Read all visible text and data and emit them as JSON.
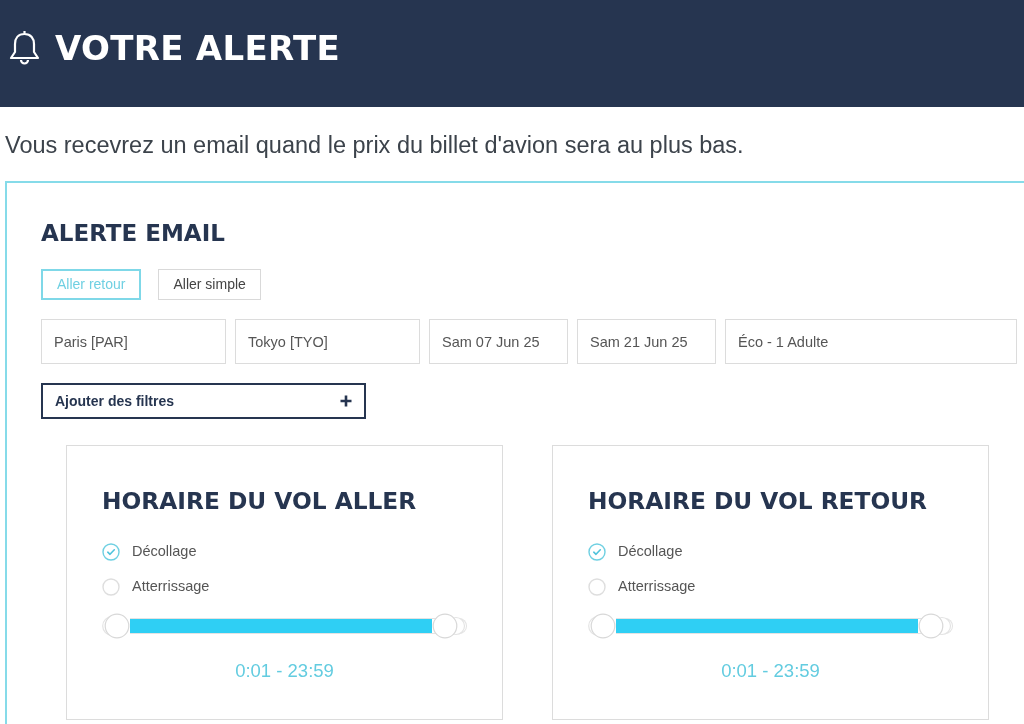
{
  "header": {
    "title": "VOTRE ALERTE"
  },
  "intro": "Vous recevrez un email quand le prix du billet d'avion sera au plus bas.",
  "alert": {
    "title": "ALERTE EMAIL",
    "trip_types": [
      {
        "label": "Aller retour",
        "selected": true
      },
      {
        "label": "Aller simple",
        "selected": false
      }
    ],
    "fields": [
      {
        "value": "Paris [PAR]"
      },
      {
        "value": "Tokyo [TYO]"
      },
      {
        "value": "Sam 07 Jun 25"
      },
      {
        "value": "Sam 21 Jun 25"
      },
      {
        "value": "Éco - 1 Adulte"
      }
    ],
    "filters_button": {
      "label": "Ajouter des filtres"
    },
    "schedules": [
      {
        "title": "HORAIRE DU VOL ALLER",
        "options": [
          {
            "label": "Décollage",
            "selected": true
          },
          {
            "label": "Atterrissage",
            "selected": false
          }
        ],
        "slider": {
          "level": 0.9
        },
        "reading": "0:01 - 23:59"
      },
      {
        "title": "HORAIRE DU VOL RETOUR",
        "options": [
          {
            "label": "Décollage",
            "selected": true
          },
          {
            "label": "Atterrissage",
            "selected": false
          }
        ],
        "slider": {
          "level": 0.9
        },
        "reading": "0:01 - 23:59"
      }
    ]
  }
}
